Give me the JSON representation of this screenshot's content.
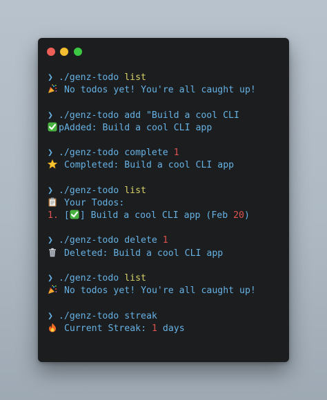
{
  "window": {
    "controls": {
      "close_color": "#ee5f57",
      "minimize_color": "#f5bd30",
      "maximize_color": "#3cc843"
    }
  },
  "colors": {
    "background": "#1b1d1f",
    "text": "#67b2e4",
    "argument": "#d9d26a",
    "number": "#e0524f"
  },
  "blocks": [
    {
      "prompt": "❯",
      "command": "./genz-todo",
      "args": [
        {
          "text": "list",
          "kind": "arg"
        }
      ],
      "output": [
        {
          "icon": "party-popper-icon",
          "glyph": "🎉",
          "segments": [
            {
              "text": "No todos yet! You're all caught up!",
              "kind": "text"
            }
          ]
        }
      ]
    },
    {
      "prompt": "❯",
      "command": "./genz-todo",
      "args": [
        {
          "text": "add \"Build a cool CLI",
          "kind": "text"
        }
      ],
      "output": [
        {
          "icon": "check-mark-icon",
          "glyph": "✅",
          "segments": [
            {
              "text": "pAdded: Build a cool CLI app",
              "kind": "text"
            }
          ]
        }
      ]
    },
    {
      "prompt": "❯",
      "command": "./genz-todo",
      "args": [
        {
          "text": "complete",
          "kind": "text"
        },
        {
          "text": "1",
          "kind": "num"
        }
      ],
      "output": [
        {
          "icon": "star-icon",
          "glyph": "🌟",
          "segments": [
            {
              "text": "Completed: Build a cool CLI app",
              "kind": "text"
            }
          ]
        }
      ]
    },
    {
      "prompt": "❯",
      "command": "./genz-todo",
      "args": [
        {
          "text": "list",
          "kind": "arg"
        }
      ],
      "output": [
        {
          "icon": "clipboard-icon",
          "glyph": "📋",
          "segments": [
            {
              "text": "Your Todos:",
              "kind": "text"
            }
          ]
        },
        {
          "icon": "",
          "glyph": "",
          "segments": [
            {
              "text": "1.",
              "kind": "num"
            },
            {
              "text": " [",
              "kind": "text"
            },
            {
              "text": "✅",
              "kind": "emoji"
            },
            {
              "text": "] Build a cool CLI app (Feb ",
              "kind": "text"
            },
            {
              "text": "20",
              "kind": "num"
            },
            {
              "text": ")",
              "kind": "text"
            }
          ]
        }
      ]
    },
    {
      "prompt": "❯",
      "command": "./genz-todo",
      "args": [
        {
          "text": "delete",
          "kind": "text"
        },
        {
          "text": "1",
          "kind": "num"
        }
      ],
      "output": [
        {
          "icon": "trash-icon",
          "glyph": "🗑️",
          "segments": [
            {
              "text": "Deleted: Build a cool CLI app",
              "kind": "text"
            }
          ]
        }
      ]
    },
    {
      "prompt": "❯",
      "command": "./genz-todo",
      "args": [
        {
          "text": "list",
          "kind": "arg"
        }
      ],
      "output": [
        {
          "icon": "party-popper-icon",
          "glyph": "🎉",
          "segments": [
            {
              "text": "No todos yet! You're all caught up!",
              "kind": "text"
            }
          ]
        }
      ]
    },
    {
      "prompt": "❯",
      "command": "./genz-todo",
      "args": [
        {
          "text": "streak",
          "kind": "text"
        }
      ],
      "output": [
        {
          "icon": "fire-icon",
          "glyph": "🔥",
          "segments": [
            {
              "text": "Current Streak:",
              "kind": "text"
            },
            {
              "text": " ",
              "kind": "text"
            },
            {
              "text": "1",
              "kind": "num"
            },
            {
              "text": " days",
              "kind": "text"
            }
          ]
        }
      ]
    }
  ]
}
